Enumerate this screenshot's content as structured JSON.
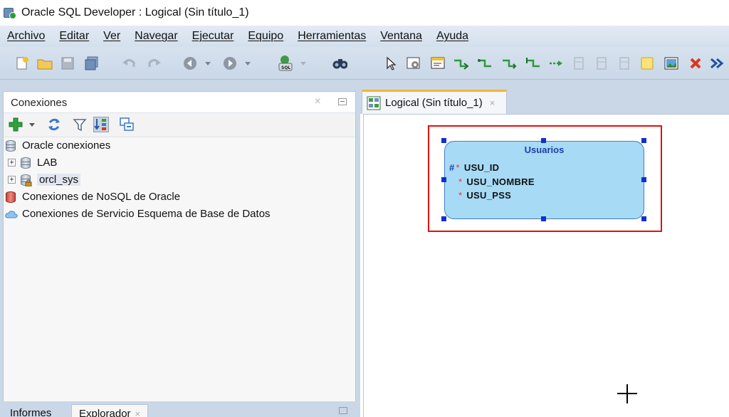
{
  "window": {
    "title": "Oracle SQL Developer : Logical (Sin título_1)"
  },
  "menu": [
    "Archivo",
    "Editar",
    "Ver",
    "Navegar",
    "Ejecutar",
    "Equipo",
    "Herramientas",
    "Ventana",
    "Ayuda"
  ],
  "toolbar": {
    "icons": [
      "new-icon",
      "open-icon",
      "save-icon",
      "save-all-icon",
      "undo-icon",
      "redo-icon",
      "back-icon",
      "forward-icon",
      "sql-worksheet-icon",
      "find-icon",
      "select-pointer-icon",
      "new-entity-icon",
      "new-view-icon",
      "relationship-icon",
      "delete-icon",
      "more-icon"
    ]
  },
  "connections_panel": {
    "title": "Conexiones",
    "close_glyph": "×",
    "tree": [
      {
        "label": "Oracle conexiones",
        "level": 0
      },
      {
        "label": "LAB",
        "level": 1,
        "expander": "+"
      },
      {
        "label": "orcl_sys",
        "level": 1,
        "expander": "+",
        "selected": true
      },
      {
        "label": "Conexiones de NoSQL de Oracle",
        "level": 0
      },
      {
        "label": "Conexiones de Servicio Esquema de Base de Datos",
        "level": 0
      }
    ]
  },
  "bottom_tabs": [
    {
      "label": "Informes"
    },
    {
      "label": "Explorador",
      "active": true,
      "close": "×"
    }
  ],
  "editor_tab": {
    "label": "Logical (Sin título_1)",
    "close": "×"
  },
  "entity": {
    "name": "Usuarios",
    "attributes": [
      {
        "pk": "#",
        "mark": "*",
        "name": "USU_ID"
      },
      {
        "pk": "",
        "mark": "*",
        "name": "USU_NOMBRE"
      },
      {
        "pk": "",
        "mark": "*",
        "name": "USU_PSS"
      }
    ]
  },
  "colors": {
    "accent_tab": "#f2b632",
    "entity_fill": "#a7daf5",
    "selection_box": "#e01010"
  }
}
